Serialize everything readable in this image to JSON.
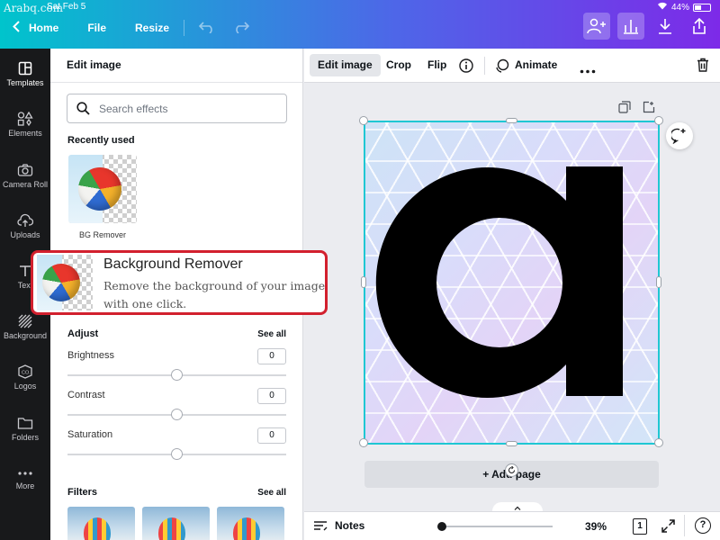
{
  "status": {
    "watermark": "Arabq.com",
    "date": "Sat Feb 5",
    "battery": "44%"
  },
  "topnav": {
    "home": "Home",
    "file": "File",
    "resize": "Resize"
  },
  "rail": [
    {
      "label": "Templates"
    },
    {
      "label": "Elements"
    },
    {
      "label": "Camera Roll"
    },
    {
      "label": "Uploads"
    },
    {
      "label": "Text"
    },
    {
      "label": "Background"
    },
    {
      "label": "Logos"
    },
    {
      "label": "Folders"
    },
    {
      "label": "More"
    }
  ],
  "panel": {
    "title": "Edit image",
    "search_placeholder": "Search effects",
    "recent_title": "Recently used",
    "recent_item": "BG Remover",
    "adjust_title": "Adjust",
    "see_all": "See all",
    "sliders": [
      {
        "label": "Brightness",
        "value": "0"
      },
      {
        "label": "Contrast",
        "value": "0"
      },
      {
        "label": "Saturation",
        "value": "0"
      }
    ],
    "filters_title": "Filters"
  },
  "callout": {
    "title": "Background Remover",
    "description": "Remove the background of your image with one click."
  },
  "toolbar": {
    "edit_image": "Edit image",
    "crop": "Crop",
    "flip": "Flip",
    "animate": "Animate"
  },
  "canvas": {
    "letter": "a",
    "add_page": "+ Add page"
  },
  "bottombar": {
    "notes": "Notes",
    "zoom": "39%",
    "page_count": "1",
    "help": "?"
  },
  "colors": {
    "accent_cyan": "#00c4cc",
    "accent_purple": "#7d2ae8",
    "selection": "#1fc7d3",
    "callout_border": "#d2202e"
  }
}
